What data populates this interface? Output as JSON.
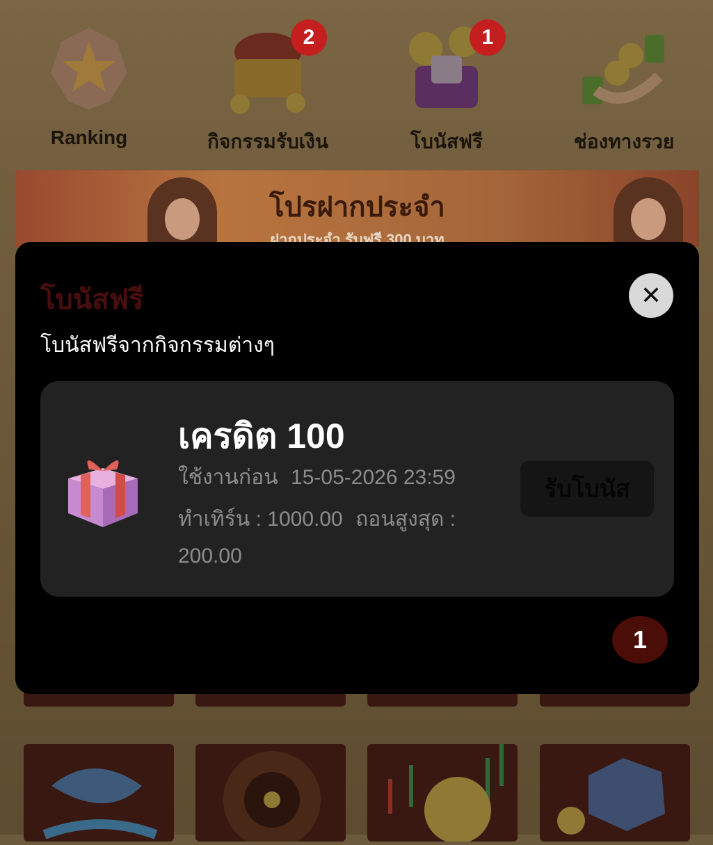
{
  "menu": {
    "items": [
      {
        "label": "Ranking",
        "icon": "trophy-star-icon",
        "badge": ""
      },
      {
        "label": "กิจกรรมรับเงิน",
        "icon": "treasure-chest-icon",
        "badge": "2"
      },
      {
        "label": "โบนัสฟรี",
        "icon": "gift-coins-icon",
        "badge": "1"
      },
      {
        "label": "ช่องทางรวย",
        "icon": "money-hand-icon",
        "badge": ""
      }
    ]
  },
  "promo": {
    "title": "โปรฝากประจำ",
    "subtitle": "ฝากประจำ รับฟรี 300 บาท"
  },
  "modal": {
    "title": "โบนัสฟรี",
    "subtitle": "โบนัสฟรีจากกิจกรรมต่างๆ",
    "close_icon": "close-icon",
    "card": {
      "title": "เครดิต 100",
      "expiry_label": "ใช้งานก่อน",
      "expiry_value": "15-05-2026  23:59",
      "turnover_label": "ทำเทิร์น : 1000.00",
      "max_withdraw_label": "ถอนสูงสุด :",
      "max_withdraw_value": "200.00",
      "claim_button": "รับโบนัส",
      "icon": "gift-box-icon"
    },
    "page_number": "1"
  },
  "colors": {
    "badge": "#c41e1e",
    "modal_bg": "#000000",
    "card_bg": "#222222"
  }
}
